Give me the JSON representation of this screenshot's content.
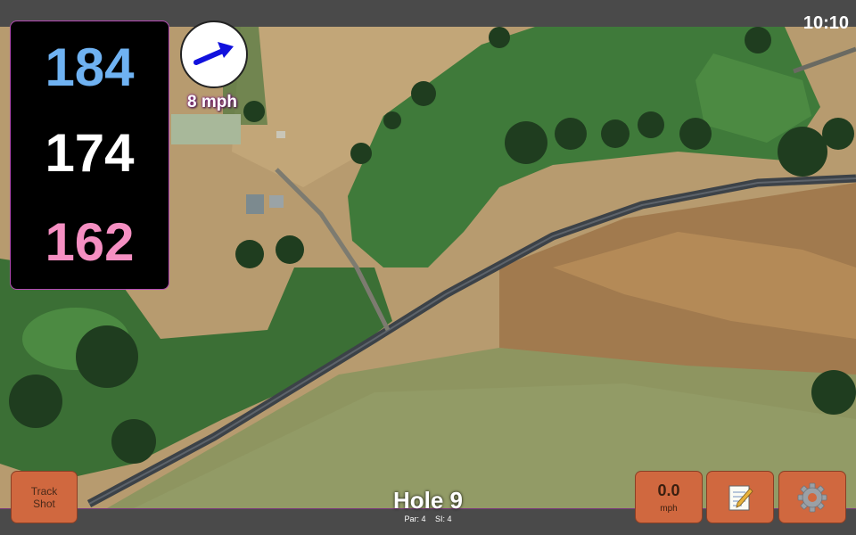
{
  "status_bar": {
    "time": "10:10"
  },
  "distances": {
    "back": "184",
    "middle": "174",
    "front": "162"
  },
  "wind": {
    "speed_label": "8 mph",
    "direction_icon": "arrow-icon"
  },
  "track_button": {
    "line1": "Track",
    "line2": "Shot"
  },
  "hole": {
    "title": "Hole 9",
    "par_label": "Par: 4",
    "si_label": "SI: 4"
  },
  "speed_button": {
    "value": "0.0",
    "unit": "mph"
  },
  "icons": {
    "notes": "notepad-icon",
    "settings": "gear-icon"
  },
  "colors": {
    "back_distance": "#6fb2f2",
    "middle_distance": "#ffffff",
    "front_distance": "#f58fc2",
    "button": "#d0683f",
    "panel_border": "#b44bb4"
  }
}
